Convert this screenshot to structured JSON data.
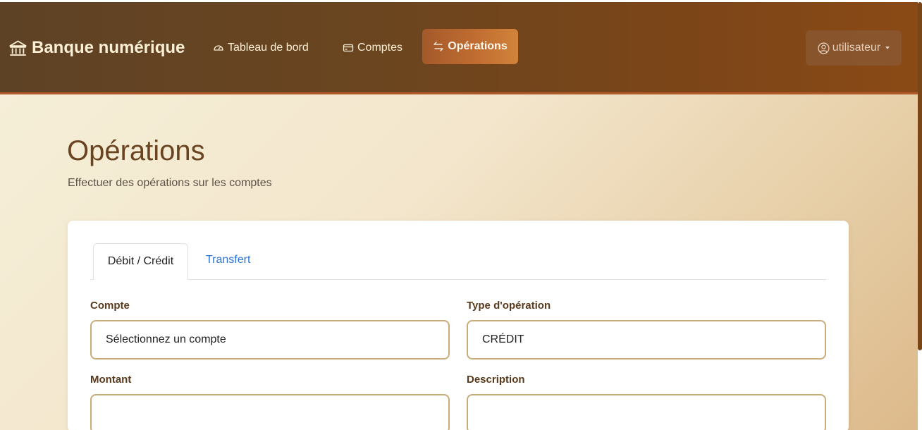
{
  "navbar": {
    "brand": "Banque numérique",
    "brand_icon": "bank-icon",
    "links": [
      {
        "label": "Tableau de bord",
        "icon": "speedometer-icon"
      },
      {
        "label": "Comptes",
        "icon": "credit-card-icon"
      },
      {
        "label": "Opérations",
        "icon": "arrows-exchange-icon",
        "active": true
      }
    ],
    "user": {
      "label": "utilisateur",
      "icon": "user-circle-icon"
    }
  },
  "page": {
    "title": "Opérations",
    "subtitle": "Effectuer des opérations sur les comptes"
  },
  "tabs": [
    {
      "label": "Débit / Crédit",
      "active": true
    },
    {
      "label": "Transfert",
      "active": false
    }
  ],
  "form": {
    "account": {
      "label": "Compte",
      "value": "Sélectionnez un compte"
    },
    "operation_type": {
      "label": "Type d'opération",
      "value": "CRÉDIT"
    },
    "amount": {
      "label": "Montant",
      "value": ""
    },
    "description": {
      "label": "Description",
      "value": ""
    }
  },
  "colors": {
    "navbar_start": "#5e4225",
    "navbar_end": "#8a4a16",
    "active_nav": "#c26e32",
    "title": "#6a4321",
    "field_border": "#c9ac7a",
    "tab_link": "#2a72d6"
  }
}
